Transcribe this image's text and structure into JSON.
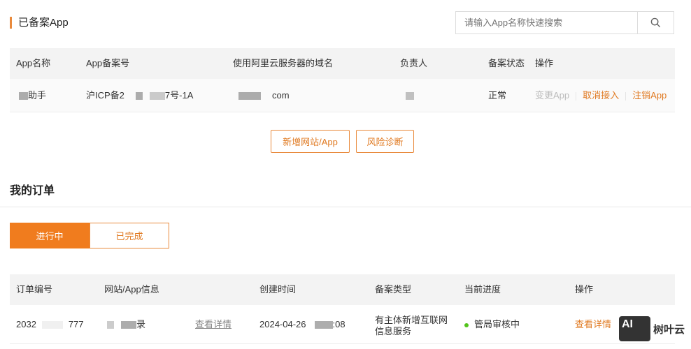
{
  "registered": {
    "title": "已备案App",
    "search_placeholder": "请输入App名称快速搜索",
    "columns": [
      "App名称",
      "App备案号",
      "使用阿里云服务器的域名",
      "负责人",
      "备案状态",
      "操作"
    ],
    "row": {
      "name": "助手",
      "icp_prefix": "沪ICP备2",
      "icp_suffix": "7号-1A",
      "domain_suffix": "com",
      "status": "正常",
      "actions": [
        "变更App",
        "取消接入",
        "注销App"
      ]
    },
    "buttons": [
      "新增网站/App",
      "风险诊断"
    ]
  },
  "orders": {
    "title": "我的订单",
    "tabs": [
      "进行中",
      "已完成"
    ],
    "columns": [
      "订单编号",
      "网站/App信息",
      "创建时间",
      "备案类型",
      "当前进度",
      "操作"
    ],
    "row": {
      "id_prefix": "2032",
      "id_suffix": "777",
      "info_suffix": "录",
      "detail_link": "查看详情",
      "created_date": "2024-04-26",
      "created_time_suffix": ":08",
      "type_line1": "有主体新增互联网",
      "type_line2": "信息服务",
      "progress": "管局审核中",
      "action": "查看详情"
    }
  },
  "watermark": {
    "logo_text": "AI",
    "brand": "树叶云"
  },
  "colors": {
    "accent": "#e98a3c",
    "success": "#52c41a"
  }
}
